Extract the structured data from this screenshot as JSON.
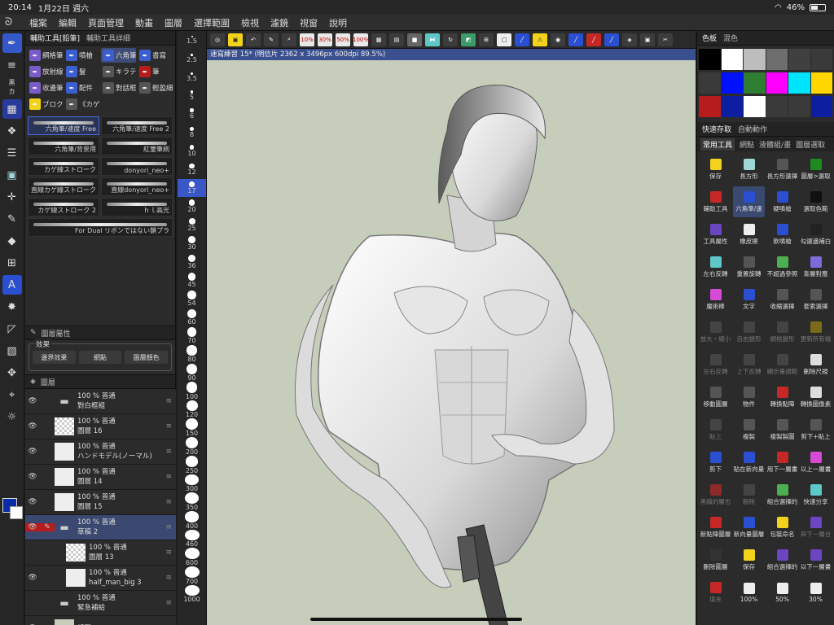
{
  "status": {
    "time": "20:14",
    "date": "1月22日 週六",
    "battery": "46%"
  },
  "menu": [
    "檔案",
    "編輯",
    "頁面管理",
    "動畫",
    "圖層",
    "選擇範圍",
    "檢視",
    "濾鏡",
    "視窗",
    "說明"
  ],
  "panels": {
    "subtool_tab": "輔助工具[鉛筆]",
    "subtool_tab2": "輔助工具詳細",
    "color_tab": "色板",
    "color_tab2": "混色",
    "quick_tab": "快速存取",
    "quick_tab2": "自動動作"
  },
  "subtools": [
    {
      "label": "網格筆",
      "color": "#7a5cc9",
      "active": false
    },
    {
      "label": "噴槍",
      "color": "#3b5fd1",
      "active": false
    },
    {
      "label": "六角筆",
      "color": "#3b5fd1",
      "active": true
    },
    {
      "label": "書寫",
      "color": "#3b5fd1",
      "active": false
    },
    {
      "label": "放射線",
      "color": "#7a5cc9",
      "active": false
    },
    {
      "label": "髮",
      "color": "#3b5fd1",
      "active": false
    },
    {
      "label": "キラテ",
      "color": "#555",
      "active": false
    },
    {
      "label": "筆",
      "color": "#b71c1c",
      "active": false
    },
    {
      "label": "收邊筆",
      "color": "#7a5cc9",
      "active": false
    },
    {
      "label": "配件",
      "color": "#3b5fd1",
      "active": false
    },
    {
      "label": "對話框",
      "color": "#555",
      "active": false
    },
    {
      "label": "輕盈細",
      "color": "#555",
      "active": false
    },
    {
      "label": "ブロク",
      "color": "#f2d21b",
      "active": false
    },
    {
      "label": "《カゲ",
      "color": "#555",
      "active": false
    }
  ],
  "brushes": [
    {
      "label": "六角筆/速度 Free",
      "active": true
    },
    {
      "label": "六角筆/速度 Free 2",
      "active": false
    },
    {
      "label": "六角筆/背景用",
      "active": false
    },
    {
      "label": "紅暈筆刷",
      "active": false
    },
    {
      "label": "カゲ線ストローク",
      "active": false
    },
    {
      "label": "donyori_neo+",
      "active": false
    },
    {
      "label": "直線カゲ線ストローク",
      "active": false
    },
    {
      "label": "直線donyori_neo+",
      "active": false
    },
    {
      "label": "カゲ線ストローク 2",
      "active": false
    },
    {
      "label": "ｈｌ高光",
      "active": false
    },
    {
      "label": "For Dual リボンではない鎖プラ",
      "active": false
    }
  ],
  "layer_prop": {
    "tab": "圖層屬性",
    "effect_label": "效果",
    "btn_border": "邊界效果",
    "btn_tone": "網點",
    "btn_color": "圖層顏色"
  },
  "layer_panel": {
    "tab": "圖層",
    "blend": "普通",
    "opacity": "100",
    "opacity_fill": 1.0
  },
  "layers": [
    {
      "pct": "100 %",
      "mode": "普通",
      "name": "對白框組",
      "type": "folder",
      "eye": true,
      "pen": false,
      "mark": "",
      "sel": false,
      "indent": 0
    },
    {
      "pct": "100 %",
      "mode": "普通",
      "name": "圖層 16",
      "type": "check",
      "eye": true,
      "pen": false,
      "mark": "",
      "sel": false,
      "indent": 0
    },
    {
      "pct": "100 %",
      "mode": "普通",
      "name": "ハンドモデル(ノーマル)",
      "type": "img",
      "eye": true,
      "pen": false,
      "mark": "",
      "sel": false,
      "indent": 0
    },
    {
      "pct": "100 %",
      "mode": "普通",
      "name": "圖層 14",
      "type": "img",
      "eye": true,
      "pen": false,
      "mark": "",
      "sel": false,
      "indent": 0
    },
    {
      "pct": "100 %",
      "mode": "普通",
      "name": "圖層 15",
      "type": "img",
      "eye": true,
      "pen": false,
      "mark": "",
      "sel": false,
      "indent": 0
    },
    {
      "pct": "100 %",
      "mode": "普通",
      "name": "草稿 2",
      "type": "folder",
      "eye": true,
      "pen": true,
      "mark": "red",
      "sel": true,
      "indent": 0
    },
    {
      "pct": "100 %",
      "mode": "普通",
      "name": "圖層 13",
      "type": "check",
      "eye": false,
      "pen": false,
      "mark": "",
      "sel": false,
      "indent": 1
    },
    {
      "pct": "100 %",
      "mode": "普通",
      "name": "half_man_big 3",
      "type": "img",
      "eye": true,
      "pen": false,
      "mark": "",
      "sel": false,
      "indent": 1
    },
    {
      "pct": "100 %",
      "mode": "普通",
      "name": "緊急補給",
      "type": "folder",
      "eye": false,
      "pen": false,
      "mark": "yellow",
      "sel": false,
      "indent": 0
    },
    {
      "pct": "",
      "mode": "",
      "name": "紙張",
      "type": "paper",
      "eye": true,
      "pen": false,
      "mark": "",
      "sel": false,
      "indent": 0
    }
  ],
  "sizes": [
    "1.5",
    "2.5",
    "3.5",
    "5",
    "6",
    "8",
    "10",
    "12",
    "17",
    "20",
    "25",
    "30",
    "36",
    "45",
    "54",
    "60",
    "70",
    "80",
    "90",
    "100",
    "120",
    "150",
    "200",
    "250",
    "300",
    "350",
    "400",
    "460",
    "600",
    "700",
    "1000"
  ],
  "active_size": "17",
  "canvas": {
    "title": "速寫練習 15* (明信片 2362 x 3496px 600dpi 89.5%)",
    "bg": "#c6cdbb"
  },
  "palette": [
    "#000000",
    "#ffffff",
    "#bdbdbd",
    "#6e6e6e",
    "#404040",
    "#3a3a3a",
    "#3a3a3a",
    "#0011ff",
    "#2e7d32",
    "#ff00ff",
    "#00e5ff",
    "#ffd600",
    "#b71c1c",
    "#0d1ea0",
    "#ffffff",
    "#3a3a3a",
    "#3a3a3a",
    "#0d1ea0"
  ],
  "quick_tabs": [
    "常用工具",
    "網點",
    "液體組/畫",
    "圖層選取"
  ],
  "quick": [
    {
      "l": "保存",
      "c": "#f2d21b"
    },
    {
      "l": "長方形",
      "c": "#9fd6d6"
    },
    {
      "l": "長方形選擇",
      "c": "#555"
    },
    {
      "l": "圖層>選取",
      "c": "#1f8a1f"
    },
    {
      "l": "輔助工具",
      "c": "#c62828"
    },
    {
      "l": "六角筆/速",
      "c": "#2a4fd0",
      "active": true
    },
    {
      "l": "硬噴槍",
      "c": "#2a4fd0"
    },
    {
      "l": "選取色範",
      "c": "#111"
    },
    {
      "l": "工具屬性",
      "c": "#6b46c1"
    },
    {
      "l": "橡皮擦",
      "c": "#eee"
    },
    {
      "l": "軟噴槍",
      "c": "#2a4fd0"
    },
    {
      "l": "勾選邊補白",
      "c": "#222"
    },
    {
      "l": "左右反轉",
      "c": "#5ec7c7"
    },
    {
      "l": "重置旋轉",
      "c": "#555"
    },
    {
      "l": "不超過參照",
      "c": "#4caf50"
    },
    {
      "l": "漸層對應",
      "c": "#7c6bd8"
    },
    {
      "l": "魔術棒",
      "c": "#d64bd6"
    },
    {
      "l": "文字",
      "c": "#2a4fd0"
    },
    {
      "l": "收縮選擇",
      "c": "#555"
    },
    {
      "l": "套索選擇",
      "c": "#555"
    },
    {
      "l": "放大・縮小",
      "c": "#444",
      "dim": true
    },
    {
      "l": "自由變形",
      "c": "#444",
      "dim": true
    },
    {
      "l": "網格變形",
      "c": "#444",
      "dim": true
    },
    {
      "l": "更新所有檔",
      "c": "#7a6a1a",
      "dim": true
    },
    {
      "l": "左右反轉",
      "c": "#444",
      "dim": true
    },
    {
      "l": "上下反轉",
      "c": "#444",
      "dim": true
    },
    {
      "l": "顯示量規範",
      "c": "#444",
      "dim": true
    },
    {
      "l": "刪除尺規",
      "c": "#ddd"
    },
    {
      "l": "移動圖層",
      "c": "#555"
    },
    {
      "l": "物件",
      "c": "#555"
    },
    {
      "l": "轉換點陣",
      "c": "#c62828"
    },
    {
      "l": "轉換圖像素",
      "c": "#ddd"
    },
    {
      "l": "貼上",
      "c": "#444",
      "dim": true
    },
    {
      "l": "複製",
      "c": "#555"
    },
    {
      "l": "複製製圖",
      "c": "#555"
    },
    {
      "l": "剪下+貼上",
      "c": "#555"
    },
    {
      "l": "剪下",
      "c": "#2a4fd0"
    },
    {
      "l": "貼在新向量",
      "c": "#2a4fd0"
    },
    {
      "l": "用下一層畫",
      "c": "#c62828"
    },
    {
      "l": "以上一層畫",
      "c": "#d64bd6"
    },
    {
      "l": "黑線的層也",
      "c": "#8e2a2a",
      "dim": true
    },
    {
      "l": "刪除",
      "c": "#444",
      "dim": true
    },
    {
      "l": "組合選擇的",
      "c": "#4caf50"
    },
    {
      "l": "快速分享",
      "c": "#5ec7c7"
    },
    {
      "l": "新點陣圖層",
      "c": "#c62828"
    },
    {
      "l": "新向量圖層",
      "c": "#2a4fd0"
    },
    {
      "l": "包裝命名",
      "c": "#f2d21b"
    },
    {
      "l": "與下一層合",
      "c": "#6b46c1",
      "dim": true
    },
    {
      "l": "刪除圖層",
      "c": "#333"
    },
    {
      "l": "保存",
      "c": "#f2d21b"
    },
    {
      "l": "組合選擇的",
      "c": "#6b46c1"
    },
    {
      "l": "以下一層畫",
      "c": "#6b46c1"
    },
    {
      "l": "填充",
      "c": "#c62828",
      "dim": true
    },
    {
      "l": "100%",
      "c": "#eee"
    },
    {
      "l": "50%",
      "c": "#eee"
    },
    {
      "l": "30%",
      "c": "#eee"
    }
  ],
  "command_icons": [
    "app-icon",
    "save-icon",
    "undo-icon",
    "wrench-icon",
    "zoom-icon",
    "hand-icon",
    "pen-icon",
    "grid-icon",
    "fill-icon",
    "color-icon",
    "rotate-icon",
    "flip-icon",
    "layer-icon",
    "select-icon",
    "paper-icon",
    "pencil-icon",
    "warning-icon",
    "camera-icon",
    "brush-icon",
    "marker-icon",
    "stack-icon",
    "gear-icon",
    "pencil2-icon"
  ],
  "cmd_labels": [
    "10%",
    "30%",
    "50%",
    "100%"
  ]
}
